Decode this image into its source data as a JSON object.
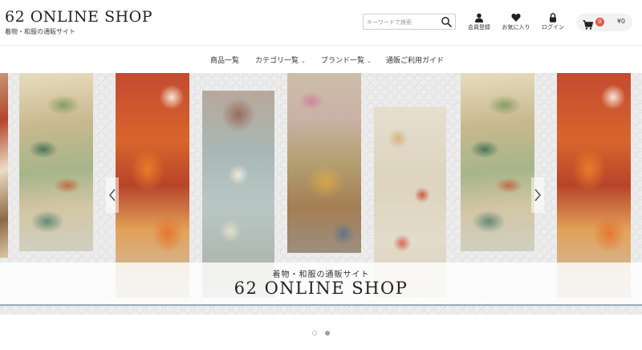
{
  "header": {
    "title": "62 ONLINE SHOP",
    "subtitle": "着物・和服の通販サイト",
    "search": {
      "placeholder": "キーワードで検索",
      "icon": "search-icon"
    },
    "icons": [
      {
        "label": "会員登録",
        "icon": "user-icon"
      },
      {
        "label": "お気に入り",
        "icon": "heart-icon"
      },
      {
        "label": "ログイン",
        "icon": "lock-icon"
      }
    ],
    "cart": {
      "icon": "cart-icon",
      "badge": "0",
      "total": "¥0",
      "badge_color": "#e25a4a"
    }
  },
  "nav": {
    "items": [
      {
        "label": "商品一覧",
        "dropdown": false
      },
      {
        "label": "カテゴリ一覧",
        "dropdown": true
      },
      {
        "label": "ブランド一覧",
        "dropdown": true
      },
      {
        "label": "通販ご利用ガイド",
        "dropdown": false
      }
    ]
  },
  "hero": {
    "caption_sub": "着物・和服の通販サイト",
    "caption_title": "62 ONLINE SHOP",
    "prev_icon": "chevron-left-icon",
    "next_icon": "chevron-right-icon",
    "accent_line_color": "#9aa9b8"
  },
  "carousel": {
    "slide_count": 2,
    "active_index": 1,
    "dot_active_color": "#8fa4bb"
  }
}
